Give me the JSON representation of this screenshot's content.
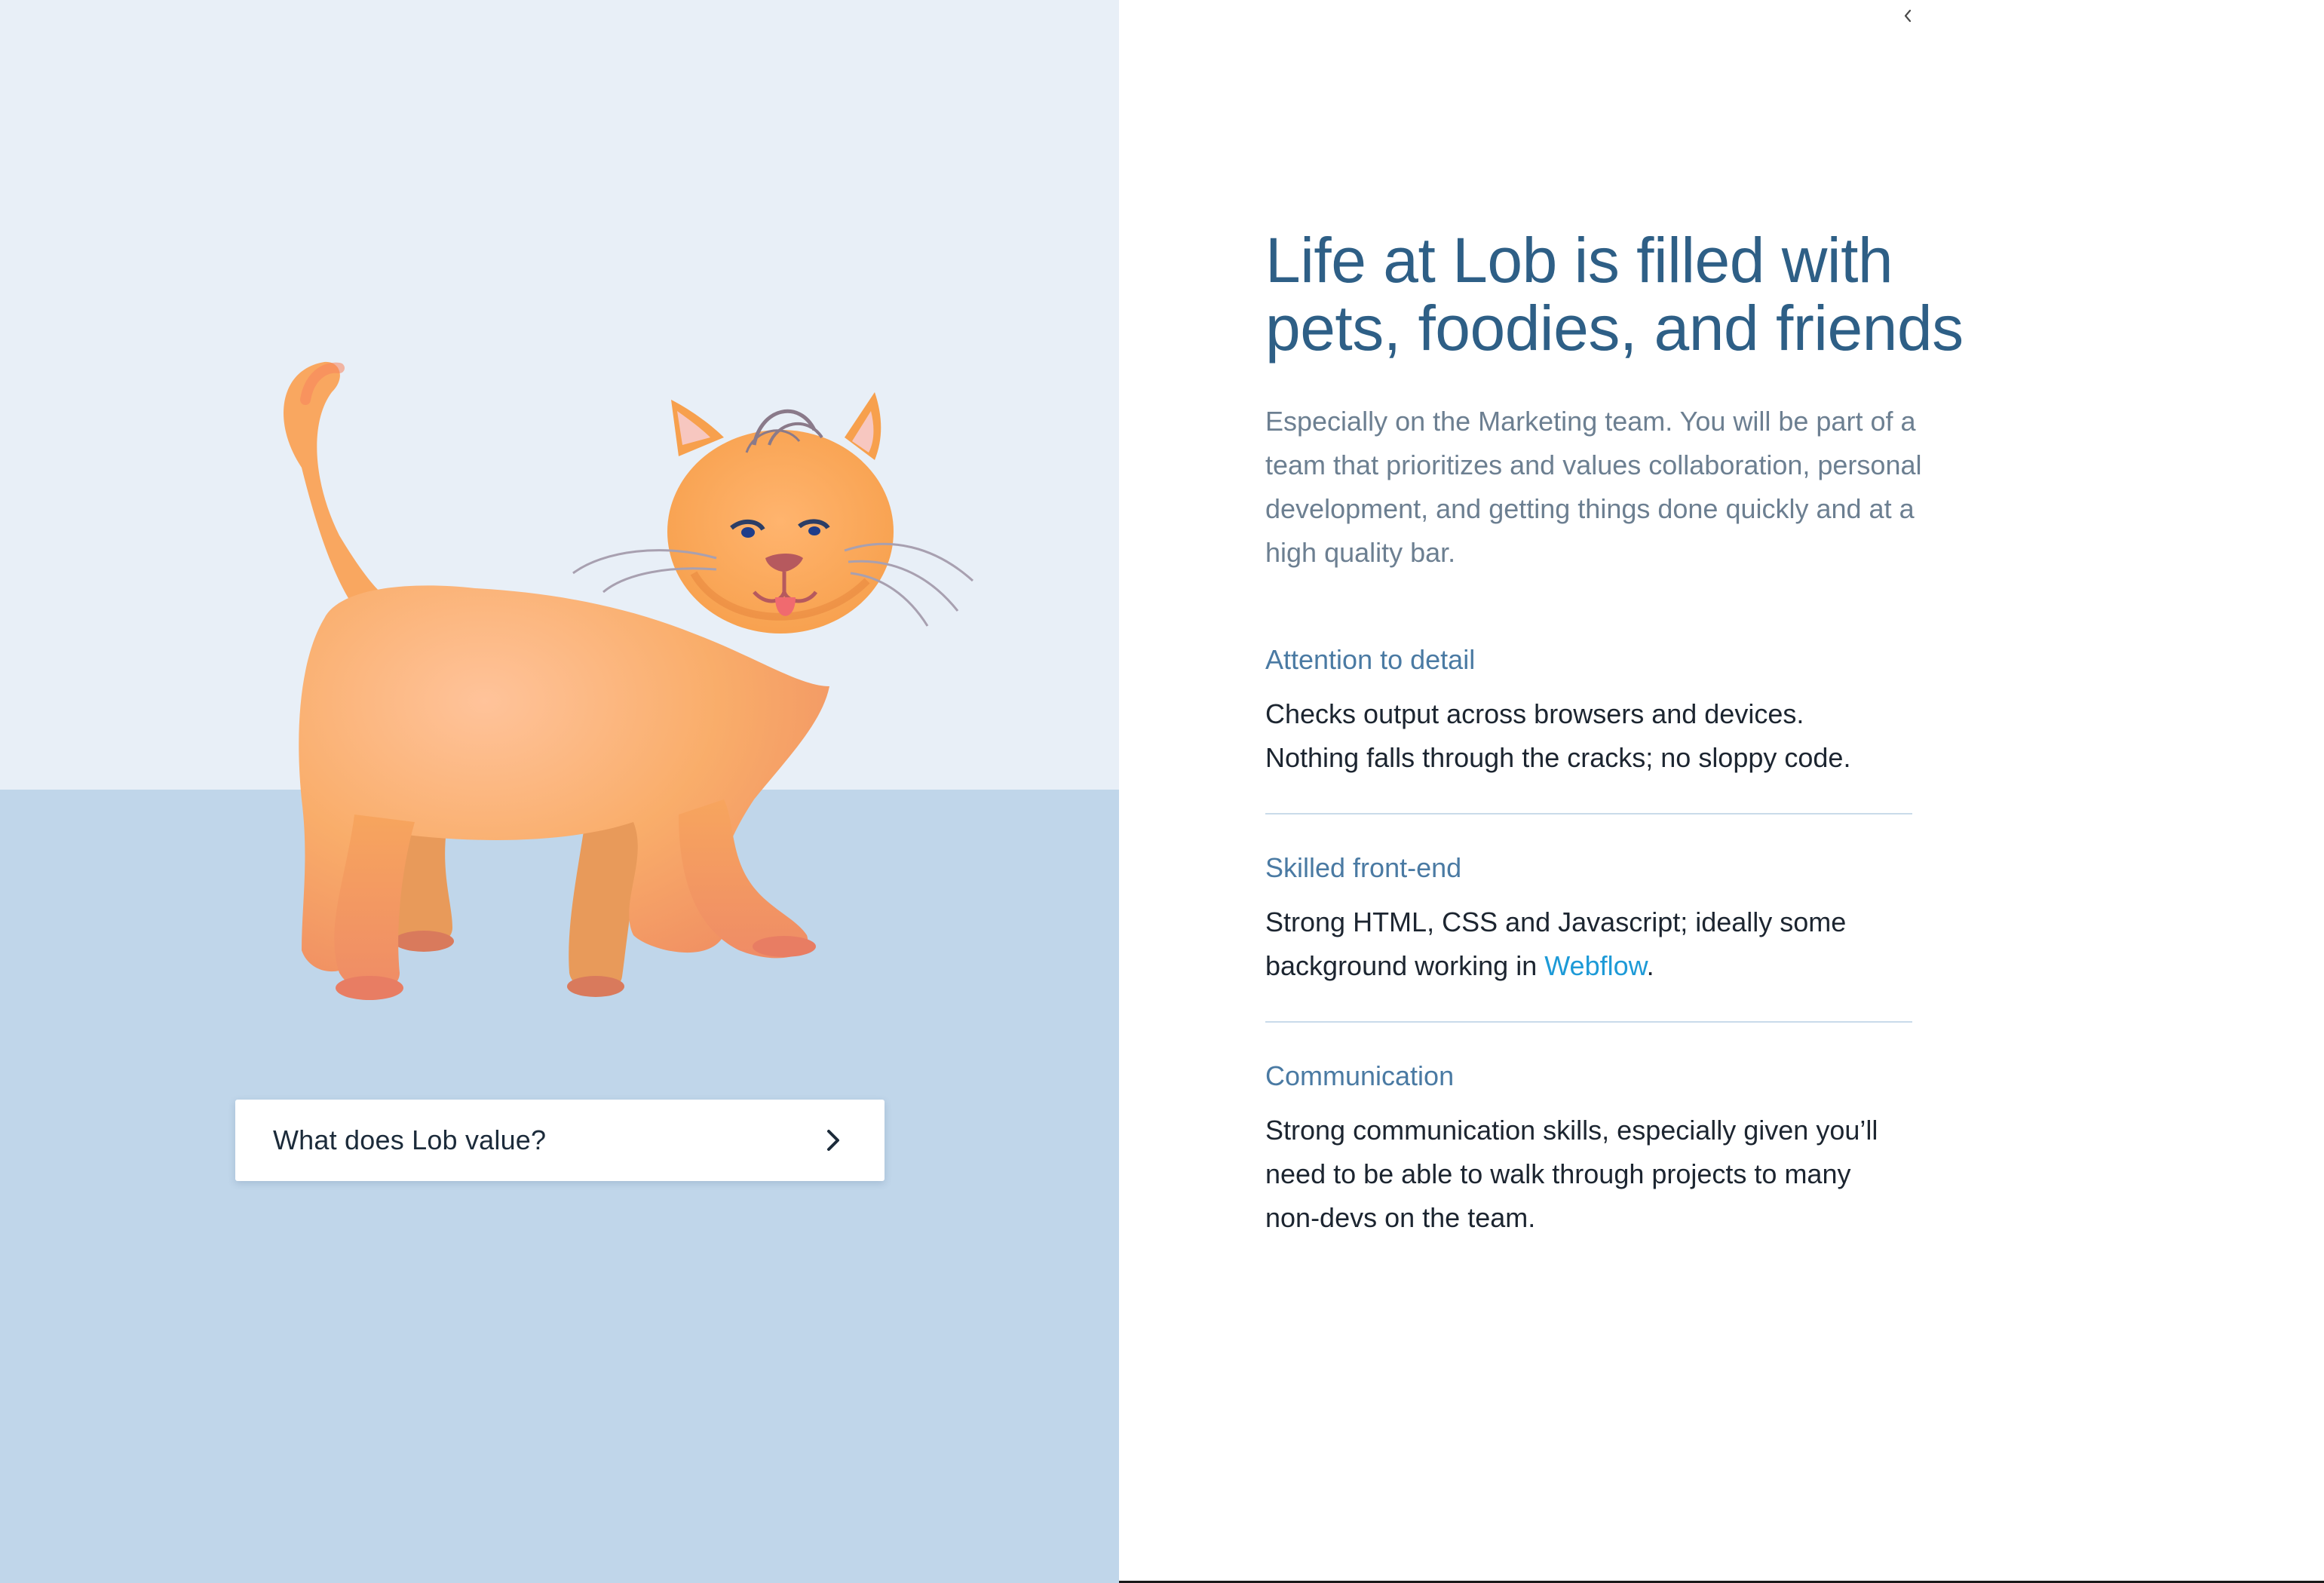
{
  "left_panel": {
    "cta_label": "What does Lob value?",
    "colors": {
      "wall": "#e8eff7",
      "floor": "#c0d6ea",
      "cat_body": "#f6a860"
    }
  },
  "right_panel": {
    "headline_line1": "Life at Lob is filled with",
    "headline_line2": "pets, foodies, and friends",
    "intro": "Especially on the Marketing team. You will be part of a team that prioritizes and values collaboration, personal development, and getting things done quickly and at a high quality bar.",
    "sections": [
      {
        "title": "Attention to detail",
        "body_line1": "Checks output across browsers and devices.",
        "body_line2": "Nothing falls through the cracks; no sloppy code."
      },
      {
        "title": "Skilled front-end",
        "body_line1": "Strong HTML, CSS and Javascript; ideally some",
        "body_prefix": "background working in ",
        "link_text": "Webflow",
        "body_suffix": "."
      },
      {
        "title": "Communication",
        "body": "Strong communication skills, especially given you’ll need to be able to walk through projects to many non-devs on the team."
      }
    ],
    "colors": {
      "headline": "#2e5f86",
      "section_title": "#4a7aa3",
      "link": "#1d9ad7"
    }
  },
  "icons": {
    "cta_icon": "chevron-right-icon",
    "collapse_icon": "chevron-left-icon"
  }
}
